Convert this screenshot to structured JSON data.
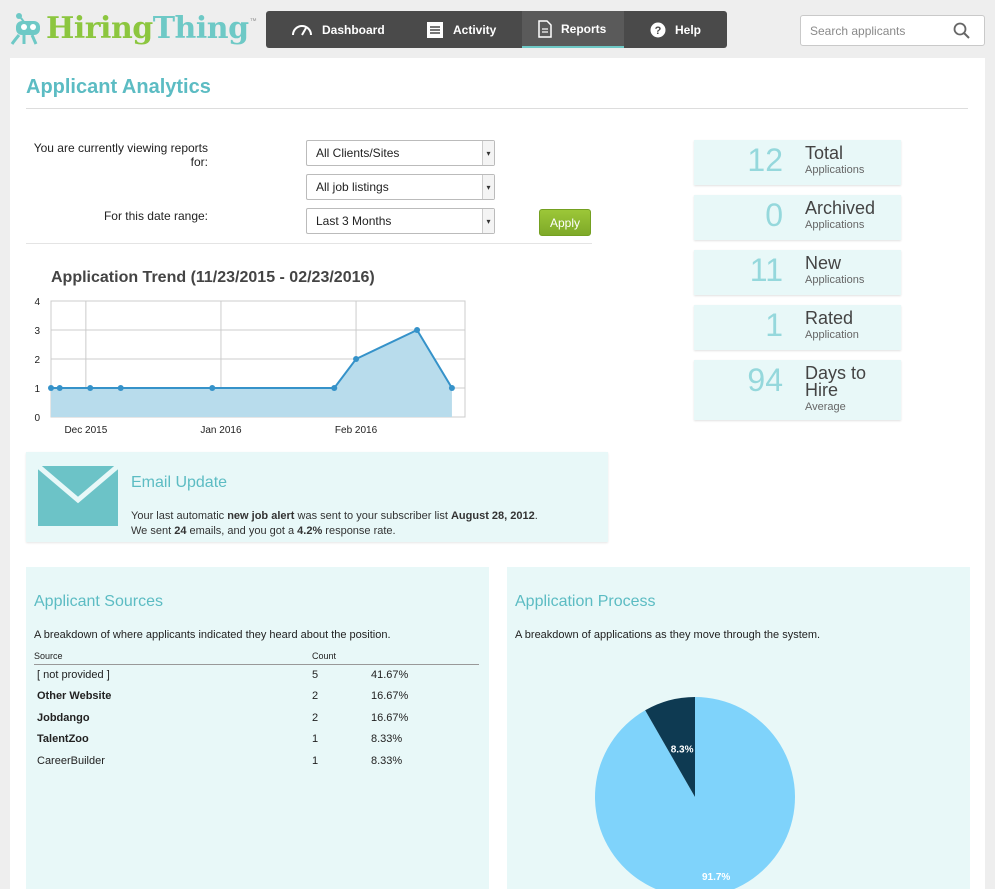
{
  "logo": {
    "hiring": "Hiring",
    "thing": "Thing",
    "tm": "™"
  },
  "nav": {
    "items": [
      {
        "label": "Dashboard"
      },
      {
        "label": "Activity"
      },
      {
        "label": "Reports"
      },
      {
        "label": "Help"
      }
    ]
  },
  "search": {
    "placeholder": "Search applicants"
  },
  "page": {
    "title": "Applicant Analytics"
  },
  "filters": {
    "viewing_label_1": "You are currently viewing reports",
    "viewing_label_2": "for:",
    "client": "All Clients/Sites",
    "job": "All job listings",
    "date_label": "For this date range:",
    "date": "Last 3 Months",
    "apply": "Apply"
  },
  "chart_data": {
    "type": "area",
    "title": "Application Trend (11/23/2015 - 02/23/2016)",
    "x": [
      "2015-11-23",
      "2015-11-25",
      "2015-12-02",
      "2015-12-09",
      "2015-12-30",
      "2016-01-27",
      "2016-02-01",
      "2016-02-15",
      "2016-02-23"
    ],
    "y": [
      1,
      1,
      1,
      1,
      1,
      1,
      2,
      3,
      1
    ],
    "xticks": [
      "Dec 2015",
      "Jan 2016",
      "Feb 2016"
    ],
    "yticks": [
      "0",
      "1",
      "2",
      "3",
      "4"
    ],
    "ylim": [
      0,
      4
    ],
    "fill_color": "#b8dcec",
    "line_color": "#3592c9"
  },
  "stats": [
    {
      "num": "12",
      "big": "Total",
      "small": "Applications"
    },
    {
      "num": "0",
      "big": "Archived",
      "small": "Applications"
    },
    {
      "num": "11",
      "big": "New",
      "small": "Applications"
    },
    {
      "num": "1",
      "big": "Rated",
      "small": "Application"
    },
    {
      "num": "94",
      "big": "Days to Hire",
      "small": "Average"
    }
  ],
  "email": {
    "title": "Email Update",
    "line1_a": "Your last automatic ",
    "line1_b": "new job alert",
    "line1_c": " was sent to your subscriber list ",
    "line1_d": "August 28, 2012",
    "line1_e": ".",
    "line2_a": "We sent ",
    "line2_b": "24",
    "line2_c": " emails, and you got a ",
    "line2_d": "4.2%",
    "line2_e": " response rate."
  },
  "sources": {
    "title": "Applicant Sources",
    "desc": "A breakdown of where applicants indicated they heard about the position.",
    "headers": {
      "source": "Source",
      "count": "Count"
    },
    "rows": [
      {
        "name": "[ not provided ]",
        "count": "5",
        "pct": "41.67%",
        "bold": false
      },
      {
        "name": "Other Website",
        "count": "2",
        "pct": "16.67%",
        "bold": true
      },
      {
        "name": "Jobdango",
        "count": "2",
        "pct": "16.67%",
        "bold": true
      },
      {
        "name": "TalentZoo",
        "count": "1",
        "pct": "8.33%",
        "bold": true
      },
      {
        "name": "CareerBuilder",
        "count": "1",
        "pct": "8.33%",
        "bold": false
      }
    ]
  },
  "process": {
    "title": "Application Process",
    "desc": "A breakdown of applications as they move through the system.",
    "pie": [
      {
        "label": "91.7%",
        "value": 91.7,
        "color": "#7fd3fb"
      },
      {
        "label": "8.3%",
        "value": 8.3,
        "color": "#0e3a52"
      }
    ]
  }
}
